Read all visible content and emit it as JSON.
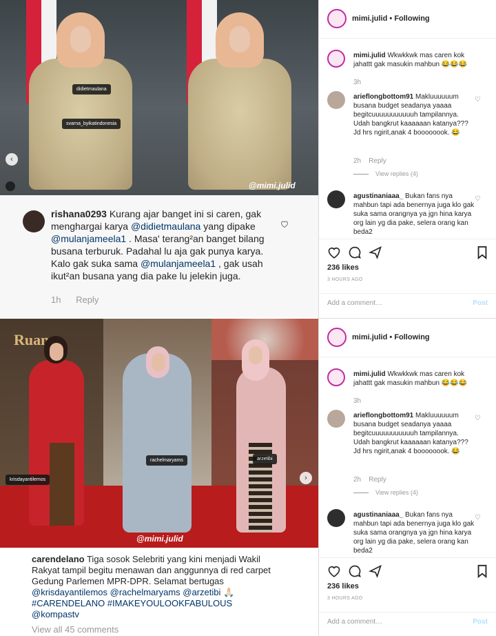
{
  "post1": {
    "tags": [
      "didietmaulana",
      "svarna_byikatindonesia"
    ],
    "watermark": "@mimi.julid",
    "nav_prev": "‹"
  },
  "comment1": {
    "username": "rishana0293",
    "text_parts": [
      "Kurang ajar banget ini si caren, gak menghargai karya ",
      "@didietmaulana",
      " yang dipake ",
      "@mulanjameela1",
      " . Masa' terang²an banget bilang busana terburuk.  Padahal lu aja gak punya karya. Kalo gak suka sama ",
      "@mulanjameela1",
      " , gak usah ikut²an busana yang dia pake lu jelekin juga."
    ],
    "time": "1h",
    "reply": "Reply"
  },
  "post2": {
    "sign_text": "Ruang",
    "tags": [
      "krisdayantilemos",
      "rachelmaryams",
      "arzetibi"
    ],
    "watermark": "@mimi.julid",
    "nav_next": "›"
  },
  "caption2": {
    "username": "carendelano",
    "text": " Tiga sosok Selebriti yang kini menjadi Wakil Rakyat tampil begitu menawan dan anggunnya di red carpet Gedung Parlemen MPR-DPR. Selamat bertugas ",
    "mentions_line": "@krisdayantilemos @rachelmaryams @arzetibi",
    "emoji": "🙏🏻",
    "hashtags": "#CARENDELANO #IMAKEYOULOOKFABULOUS",
    "kompas": "@kompastv",
    "view_all": "View all 45 comments"
  },
  "panels": [
    {
      "header": {
        "username": "mimi.julid",
        "follow": "Following"
      },
      "caption": {
        "username": "mimi.julid",
        "text": " Wkwkkwk mas caren kok jahattt gak masukin mahbun 😂😂😂",
        "time": "3h"
      },
      "comments": [
        {
          "username": "arieflongbottom91",
          "text": " Makluuuuuum busana budget seadanya yaaaa begitcuuuuuuuuuuuh tampilannya. Udah bangkrut kaaaaaan katanya??? Jd hrs ngirit,anak 4 boooooook. 😂",
          "time": "2h",
          "reply": "Reply",
          "view_replies": "View replies (4)"
        },
        {
          "username": "agustinaniaaa_",
          "text": " Bukan fans nya mahbun tapi ada benernya juga klo gak suka sama orangnya ya jgn hina karya org lain yg dia pake, selera orang kan beda2"
        }
      ],
      "likes": "236 likes",
      "ago": "3 HOURS AGO",
      "add_comment": "Add a comment…",
      "post": "Post"
    },
    {
      "header": {
        "username": "mimi.julid",
        "follow": "Following"
      },
      "caption": {
        "username": "mimi.julid",
        "text": " Wkwkkwk mas caren kok jahattt gak masukin mahbun 😂😂😂",
        "time": "3h"
      },
      "comments": [
        {
          "username": "arieflongbottom91",
          "text": " Makluuuuuum busana budget seadanya yaaaa begitcuuuuuuuuuuuh tampilannya. Udah bangkrut kaaaaaan katanya??? Jd hrs ngirit,anak 4 boooooook. 😂",
          "time": "2h",
          "reply": "Reply",
          "view_replies": "View replies (4)"
        },
        {
          "username": "agustinaniaaa_",
          "text": " Bukan fans nya mahbun tapi ada benernya juga klo gak suka sama orangnya ya jgn hina karya org lain yg dia pake, selera orang kan beda2"
        }
      ],
      "likes": "236 likes",
      "ago": "3 HOURS AGO",
      "add_comment": "Add a comment…",
      "post": "Post"
    }
  ],
  "icons": {
    "heart": "heart-icon",
    "comment": "comment-icon",
    "share": "share-icon",
    "bookmark": "bookmark-icon",
    "small_heart": "heart-outline-icon"
  },
  "colors": {
    "mention": "#003569",
    "muted": "#999999",
    "post_disabled": "#b2dffc",
    "carpet": "#b81c1c"
  }
}
